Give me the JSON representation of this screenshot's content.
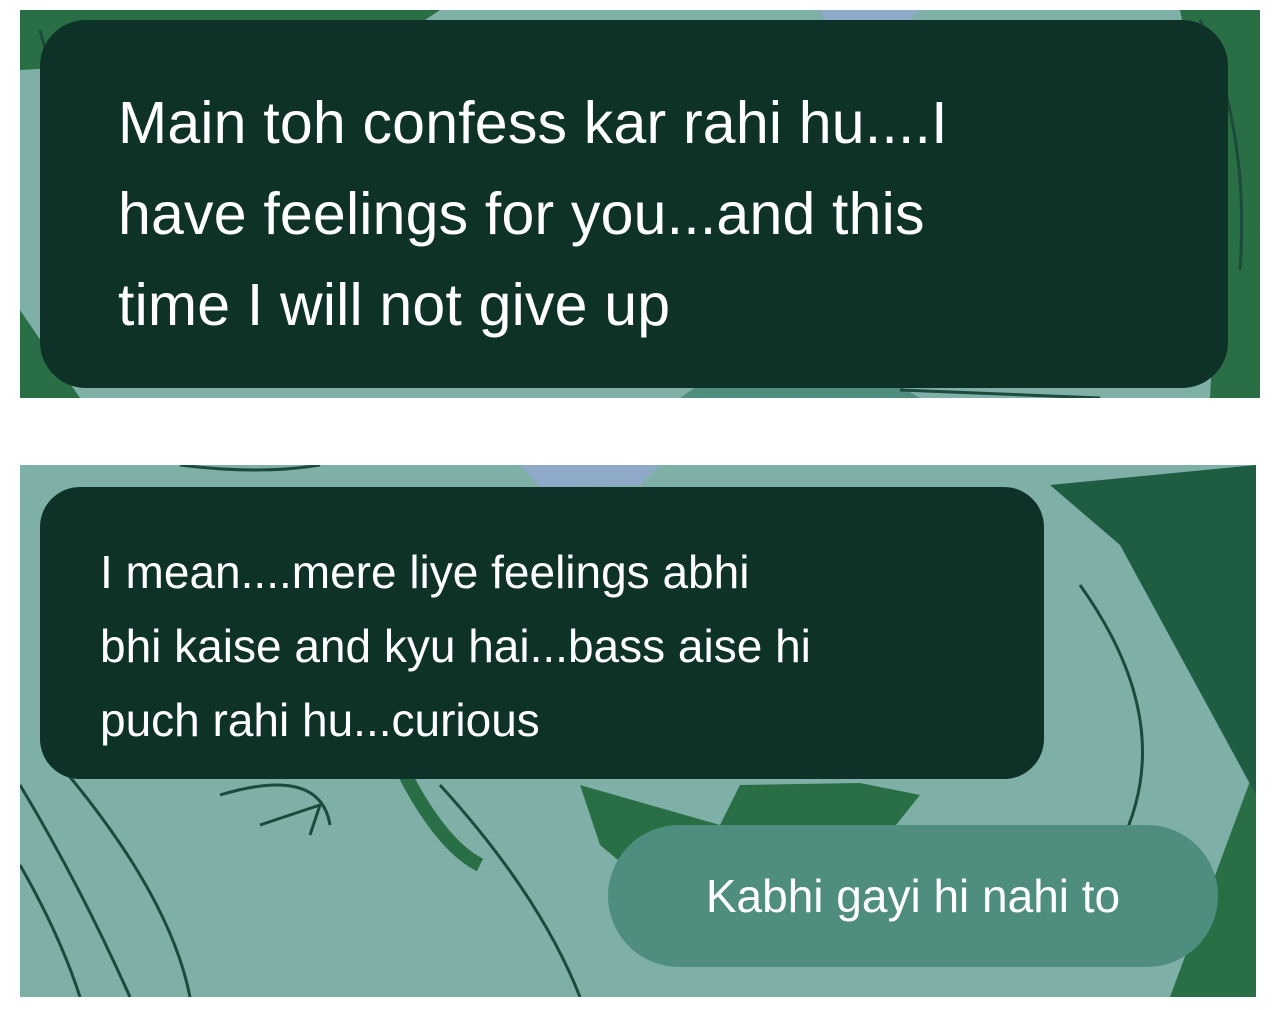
{
  "conversation": {
    "messages": [
      {
        "direction": "received",
        "text": "Main toh confess kar rahi hu....I\nhave feelings for you...and this\ntime I will not give up"
      },
      {
        "direction": "received",
        "text": "I mean....mere liye feelings abhi\nbhi kaise and kyu hai...bass aise hi\npuch rahi hu...curious"
      },
      {
        "direction": "sent",
        "text": "Kabhi gayi hi nahi to"
      }
    ]
  },
  "colors": {
    "received_bubble": "#0e3128",
    "sent_bubble": "#4f8e7f",
    "wallpaper_light": "#7fb0a8",
    "wallpaper_dark": "#2a6e45",
    "text": "#ffffff"
  }
}
